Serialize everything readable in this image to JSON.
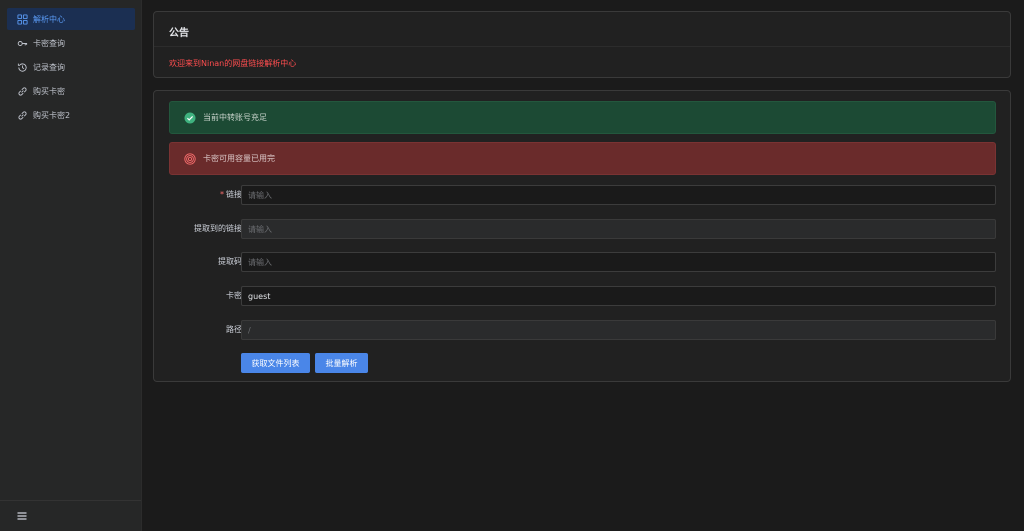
{
  "sidebar": {
    "items": [
      {
        "label": "解析中心",
        "icon": "grid-icon",
        "active": true
      },
      {
        "label": "卡密查询",
        "icon": "key-icon",
        "active": false
      },
      {
        "label": "记录查询",
        "icon": "history-icon",
        "active": false
      },
      {
        "label": "购买卡密",
        "icon": "link-icon",
        "active": false
      },
      {
        "label": "购买卡密2",
        "icon": "link-icon",
        "active": false
      }
    ],
    "footer_icon": "menu-icon"
  },
  "notice": {
    "title": "公告",
    "text": "欢迎来到Ninan的网盘链接解析中心"
  },
  "alerts": {
    "success": "当前中转账号充足",
    "error": "卡密可用容量已用完"
  },
  "form": {
    "link": {
      "label": "链接",
      "required": true,
      "value": "",
      "placeholder": "请输入"
    },
    "extracted_link": {
      "label": "提取到的链接",
      "value": "",
      "placeholder": "请输入"
    },
    "code": {
      "label": "提取码",
      "value": "",
      "placeholder": "请输入"
    },
    "card": {
      "label": "卡密",
      "value": "guest",
      "placeholder": ""
    },
    "path": {
      "label": "路径",
      "value": "",
      "placeholder": "/"
    }
  },
  "buttons": {
    "get_list": "获取文件列表",
    "batch_parse": "批量解析"
  },
  "colors": {
    "accent": "#4a86e8",
    "notice_text": "#ff4d4f",
    "success_bg": "#1c4a34",
    "error_bg": "#6a2b2b"
  }
}
